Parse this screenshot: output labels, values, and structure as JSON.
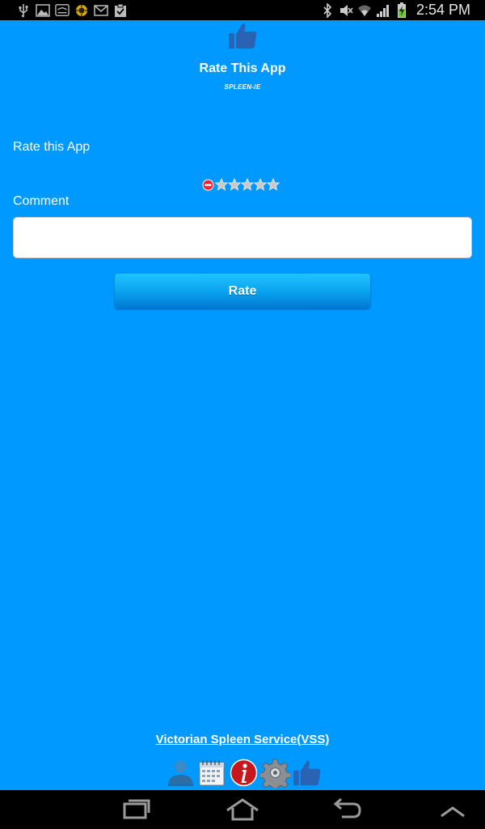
{
  "status_bar": {
    "time": "2:54 PM",
    "left_icons": [
      "usb-icon",
      "image-icon",
      "cast-icon",
      "virus-scan-icon",
      "mail-icon",
      "clipboard-check-icon"
    ],
    "right_icons": [
      "bluetooth-icon",
      "mute-icon",
      "wifi-icon",
      "signal-icon",
      "battery-charging-icon"
    ]
  },
  "header": {
    "icon": "thumbs-up-icon",
    "title": "Rate This App",
    "subtitle": "SPLEEN-IE"
  },
  "form": {
    "rate_label": "Rate this App",
    "rating": {
      "value": 0,
      "max": 5
    },
    "comment_label": "Comment",
    "comment_value": "",
    "rate_button": "Rate"
  },
  "footer": {
    "link_text": "Victorian Spleen Service(VSS)",
    "icons": [
      "contact-icon",
      "calendar-icon",
      "info-icon",
      "settings-icon",
      "thumbs-up-icon"
    ]
  },
  "nav_bar": {
    "buttons": [
      "recent-apps-icon",
      "home-icon",
      "back-icon",
      "menu-up-icon"
    ]
  },
  "colors": {
    "background": "#0099ff",
    "button_top": "#1fc3ff",
    "button_bottom": "#0078d4",
    "icon_blue": "#2a62b4"
  }
}
